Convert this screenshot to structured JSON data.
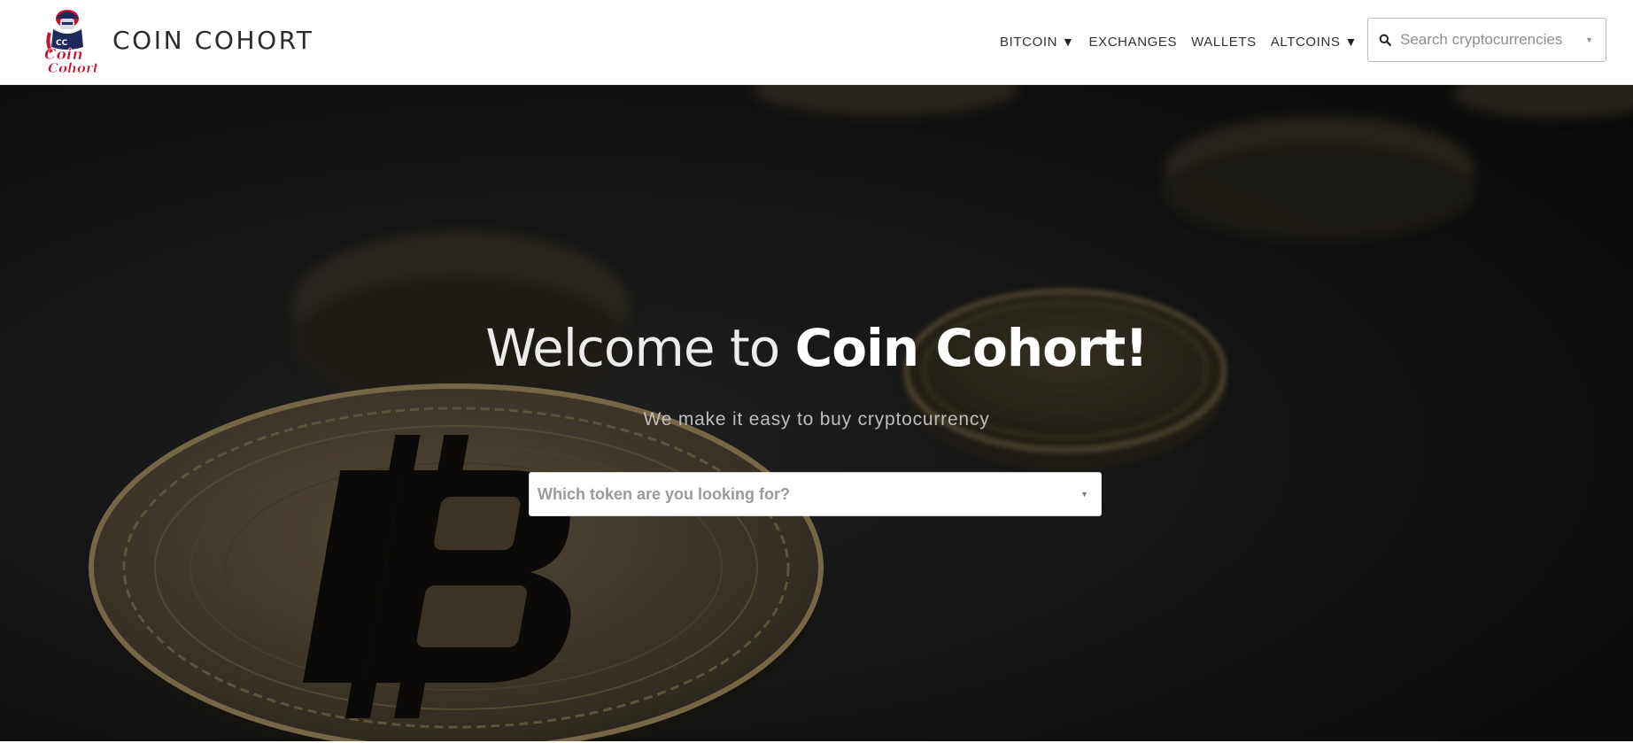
{
  "brand": {
    "name": "COIN COHORT",
    "logo_text_top": "CC",
    "logo_text_mid": "Coin",
    "logo_text_bottom": "Cohort"
  },
  "nav": {
    "items": [
      {
        "label": "BITCOIN",
        "has_dropdown": true,
        "caret": "▼"
      },
      {
        "label": "EXCHANGES",
        "has_dropdown": false
      },
      {
        "label": "WALLETS",
        "has_dropdown": false
      },
      {
        "label": "ALTCOINS",
        "has_dropdown": true,
        "caret": "▼"
      }
    ],
    "search": {
      "placeholder": "Search cryptocurrencies",
      "icon": "search-icon",
      "arrow": "▼"
    }
  },
  "hero": {
    "title_prefix": "Welcome to ",
    "title_strong": "Coin Cohort!",
    "subtitle": "We make it easy to buy cryptocurrency",
    "select": {
      "placeholder": "Which token are you looking for?",
      "arrow": "▼"
    }
  },
  "colors": {
    "brand_text": "#2b2b2b",
    "logo_red": "#c8102e",
    "logo_navy": "#1f2a5c",
    "hero_bg": "#121212",
    "coin_gold": "#b59a5a"
  }
}
